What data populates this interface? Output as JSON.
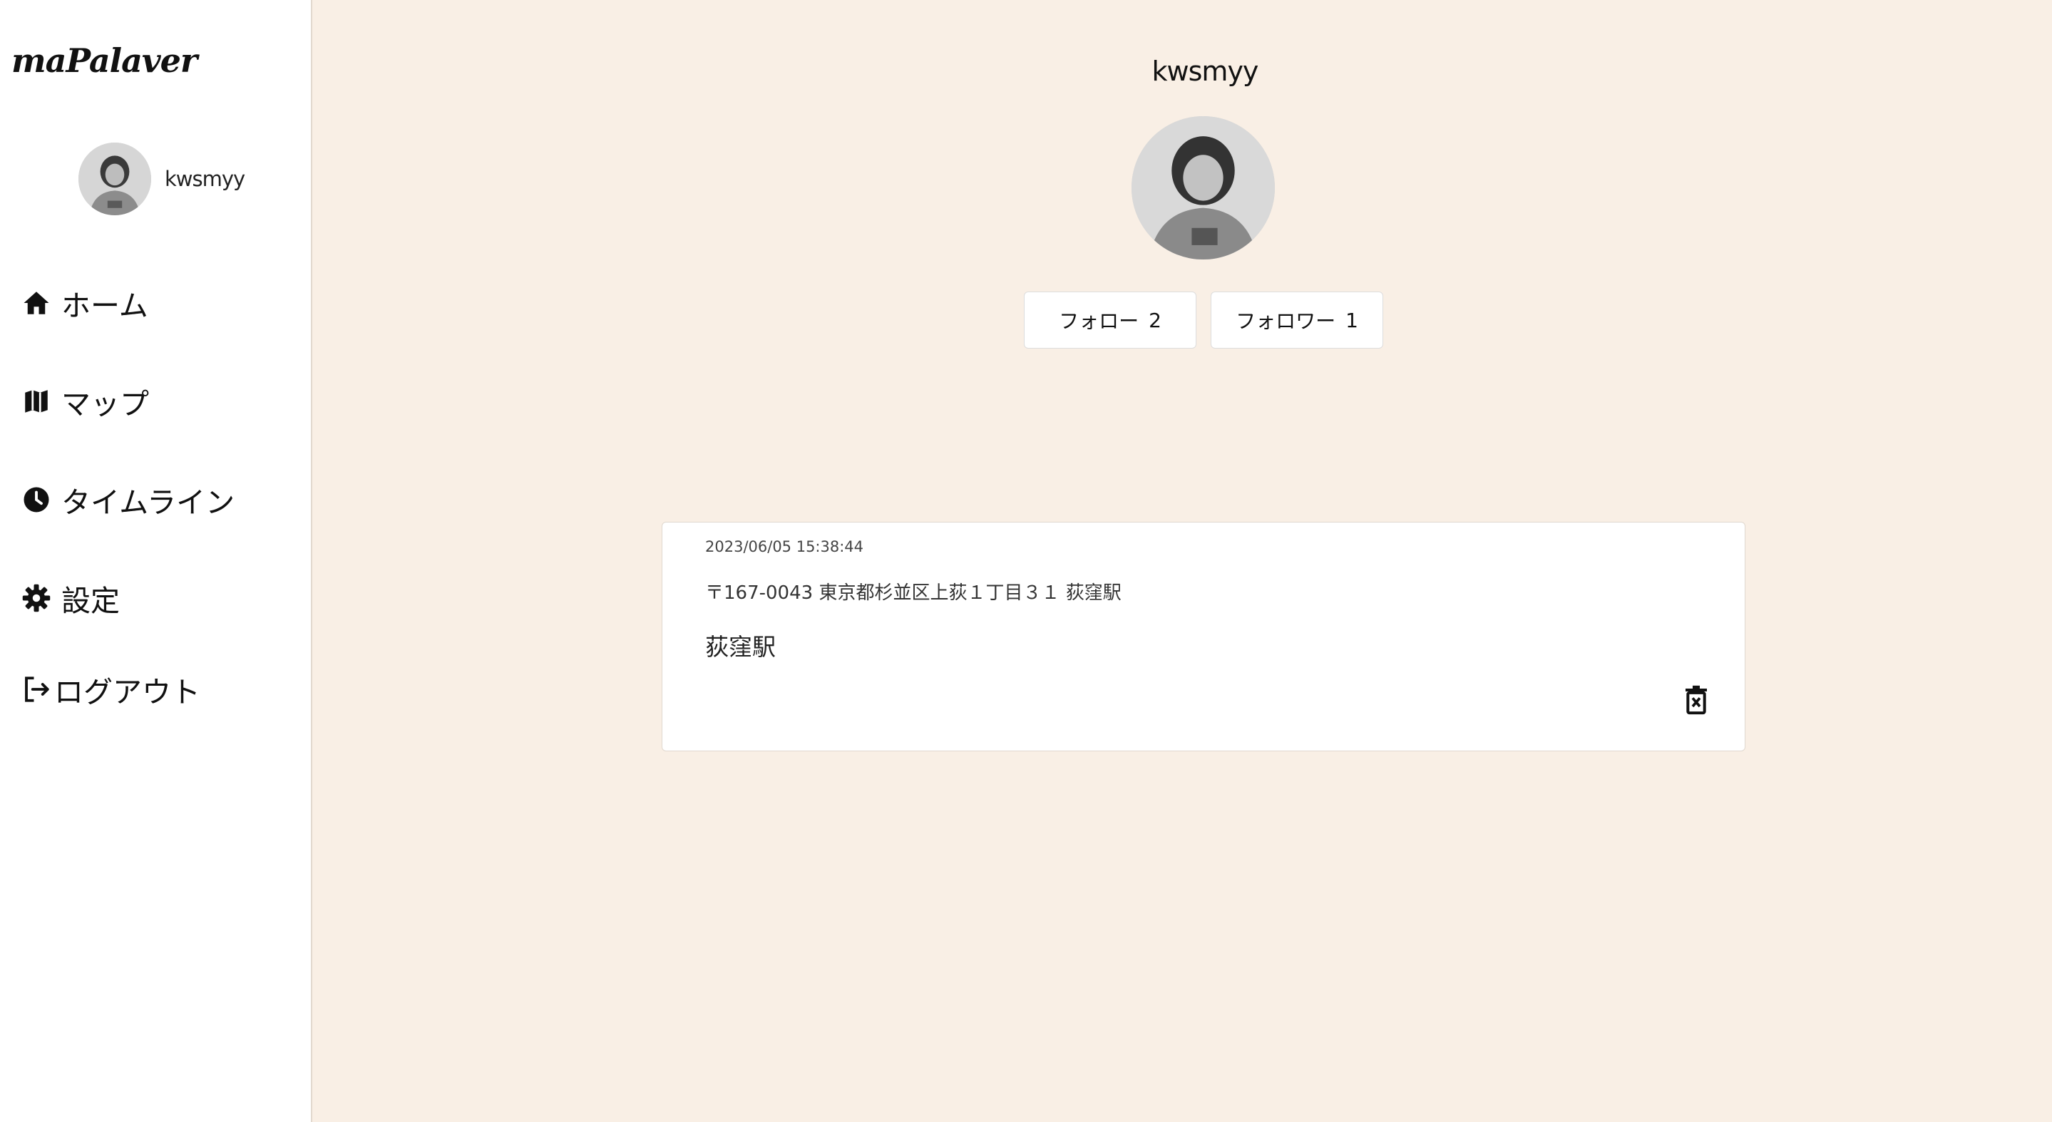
{
  "app": {
    "logo": "maPalaver"
  },
  "sidebar": {
    "username": "kwsmyy",
    "nav": [
      {
        "label": "ホーム",
        "icon": "home-icon"
      },
      {
        "label": "マップ",
        "icon": "map-icon"
      },
      {
        "label": "タイムライン",
        "icon": "clock-icon"
      },
      {
        "label": "設定",
        "icon": "gear-icon"
      },
      {
        "label": "ログアウト",
        "icon": "logout-icon"
      }
    ]
  },
  "profile": {
    "username": "kwsmyy",
    "follow": {
      "label": "フォロー",
      "count": "2"
    },
    "follower": {
      "label": "フォロワー",
      "count": "1"
    }
  },
  "posts": [
    {
      "timestamp": "2023/06/05 15:38:44",
      "address": "〒167-0043 東京都杉並区上荻１丁目３１ 荻窪駅",
      "title": "荻窪駅",
      "delete_icon": "trash-icon"
    }
  ],
  "colors": {
    "background": "#f9efe5",
    "sidebar": "#ffffff",
    "card": "#ffffff"
  }
}
